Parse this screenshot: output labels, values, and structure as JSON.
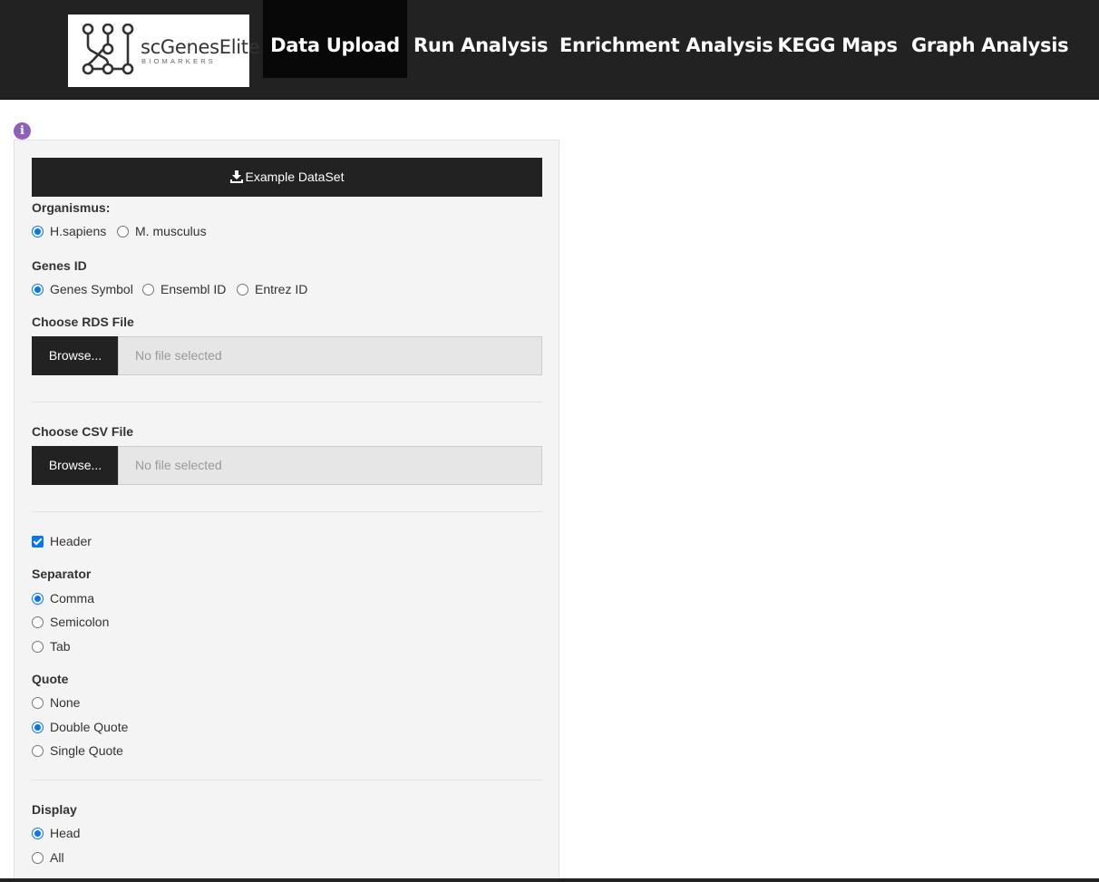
{
  "brand": {
    "name": "scGenesElite",
    "subtitle": "BIOMARKERS"
  },
  "nav": {
    "items": [
      {
        "label": "Data Upload",
        "active": true
      },
      {
        "label": "Run Analysis",
        "active": false
      },
      {
        "label": "Enrichment Analysis",
        "active": false
      },
      {
        "label": "KEGG Maps",
        "active": false
      },
      {
        "label": "Graph Analysis",
        "active": false
      }
    ]
  },
  "info_icon": {
    "icon": "info-icon",
    "glyph": "i",
    "color": "#8e5fbf"
  },
  "panel": {
    "example_button": {
      "label": "Example DataSet",
      "icon": "download-icon"
    },
    "organism": {
      "label": "Organismus:",
      "options": [
        {
          "label": "H.sapiens",
          "selected": true
        },
        {
          "label": "M. musculus",
          "selected": false
        }
      ]
    },
    "genes_id": {
      "label": "Genes ID",
      "options": [
        {
          "label": "Genes Symbol",
          "selected": true
        },
        {
          "label": "Ensembl ID",
          "selected": false
        },
        {
          "label": "Entrez ID",
          "selected": false
        }
      ]
    },
    "rds_file": {
      "label": "Choose RDS File",
      "button": "Browse...",
      "placeholder": "No file selected"
    },
    "csv_file": {
      "label": "Choose CSV File",
      "button": "Browse...",
      "placeholder": "No file selected"
    },
    "header_checkbox": {
      "label": "Header",
      "checked": true
    },
    "separator": {
      "label": "Separator",
      "options": [
        {
          "label": "Comma",
          "selected": true
        },
        {
          "label": "Semicolon",
          "selected": false
        },
        {
          "label": "Tab",
          "selected": false
        }
      ]
    },
    "quote": {
      "label": "Quote",
      "options": [
        {
          "label": "None",
          "selected": false
        },
        {
          "label": "Double Quote",
          "selected": true
        },
        {
          "label": "Single Quote",
          "selected": false
        }
      ]
    },
    "display": {
      "label": "Display",
      "options": [
        {
          "label": "Head",
          "selected": true
        },
        {
          "label": "All",
          "selected": false
        }
      ]
    }
  },
  "colors": {
    "navbar": "#222222",
    "accent": "#0075ff",
    "panel_bg": "#f4f4f4"
  }
}
